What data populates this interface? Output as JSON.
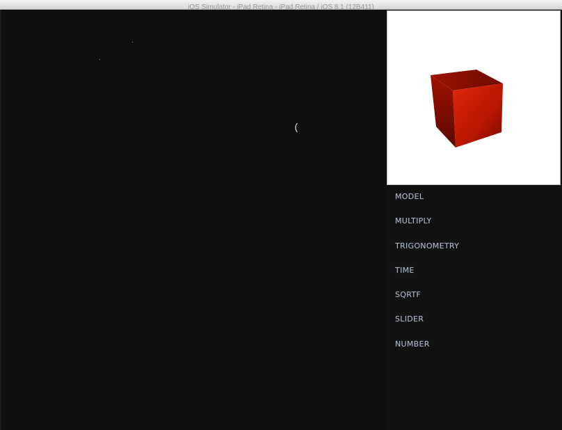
{
  "window": {
    "title": "iOS Simulator - iPad Retina - iPad Retina / iOS 8.1 (12B411)"
  },
  "canvas": {
    "cursor_glyph": "("
  },
  "preview": {
    "object": "cube",
    "color": "#cc1a00"
  },
  "menu": {
    "items": [
      {
        "label": "MODEL"
      },
      {
        "label": "MULTIPLY"
      },
      {
        "label": "TRIGONOMETRY"
      },
      {
        "label": "TIME"
      },
      {
        "label": "SQRTF"
      },
      {
        "label": "SLIDER"
      },
      {
        "label": "NUMBER"
      }
    ]
  }
}
